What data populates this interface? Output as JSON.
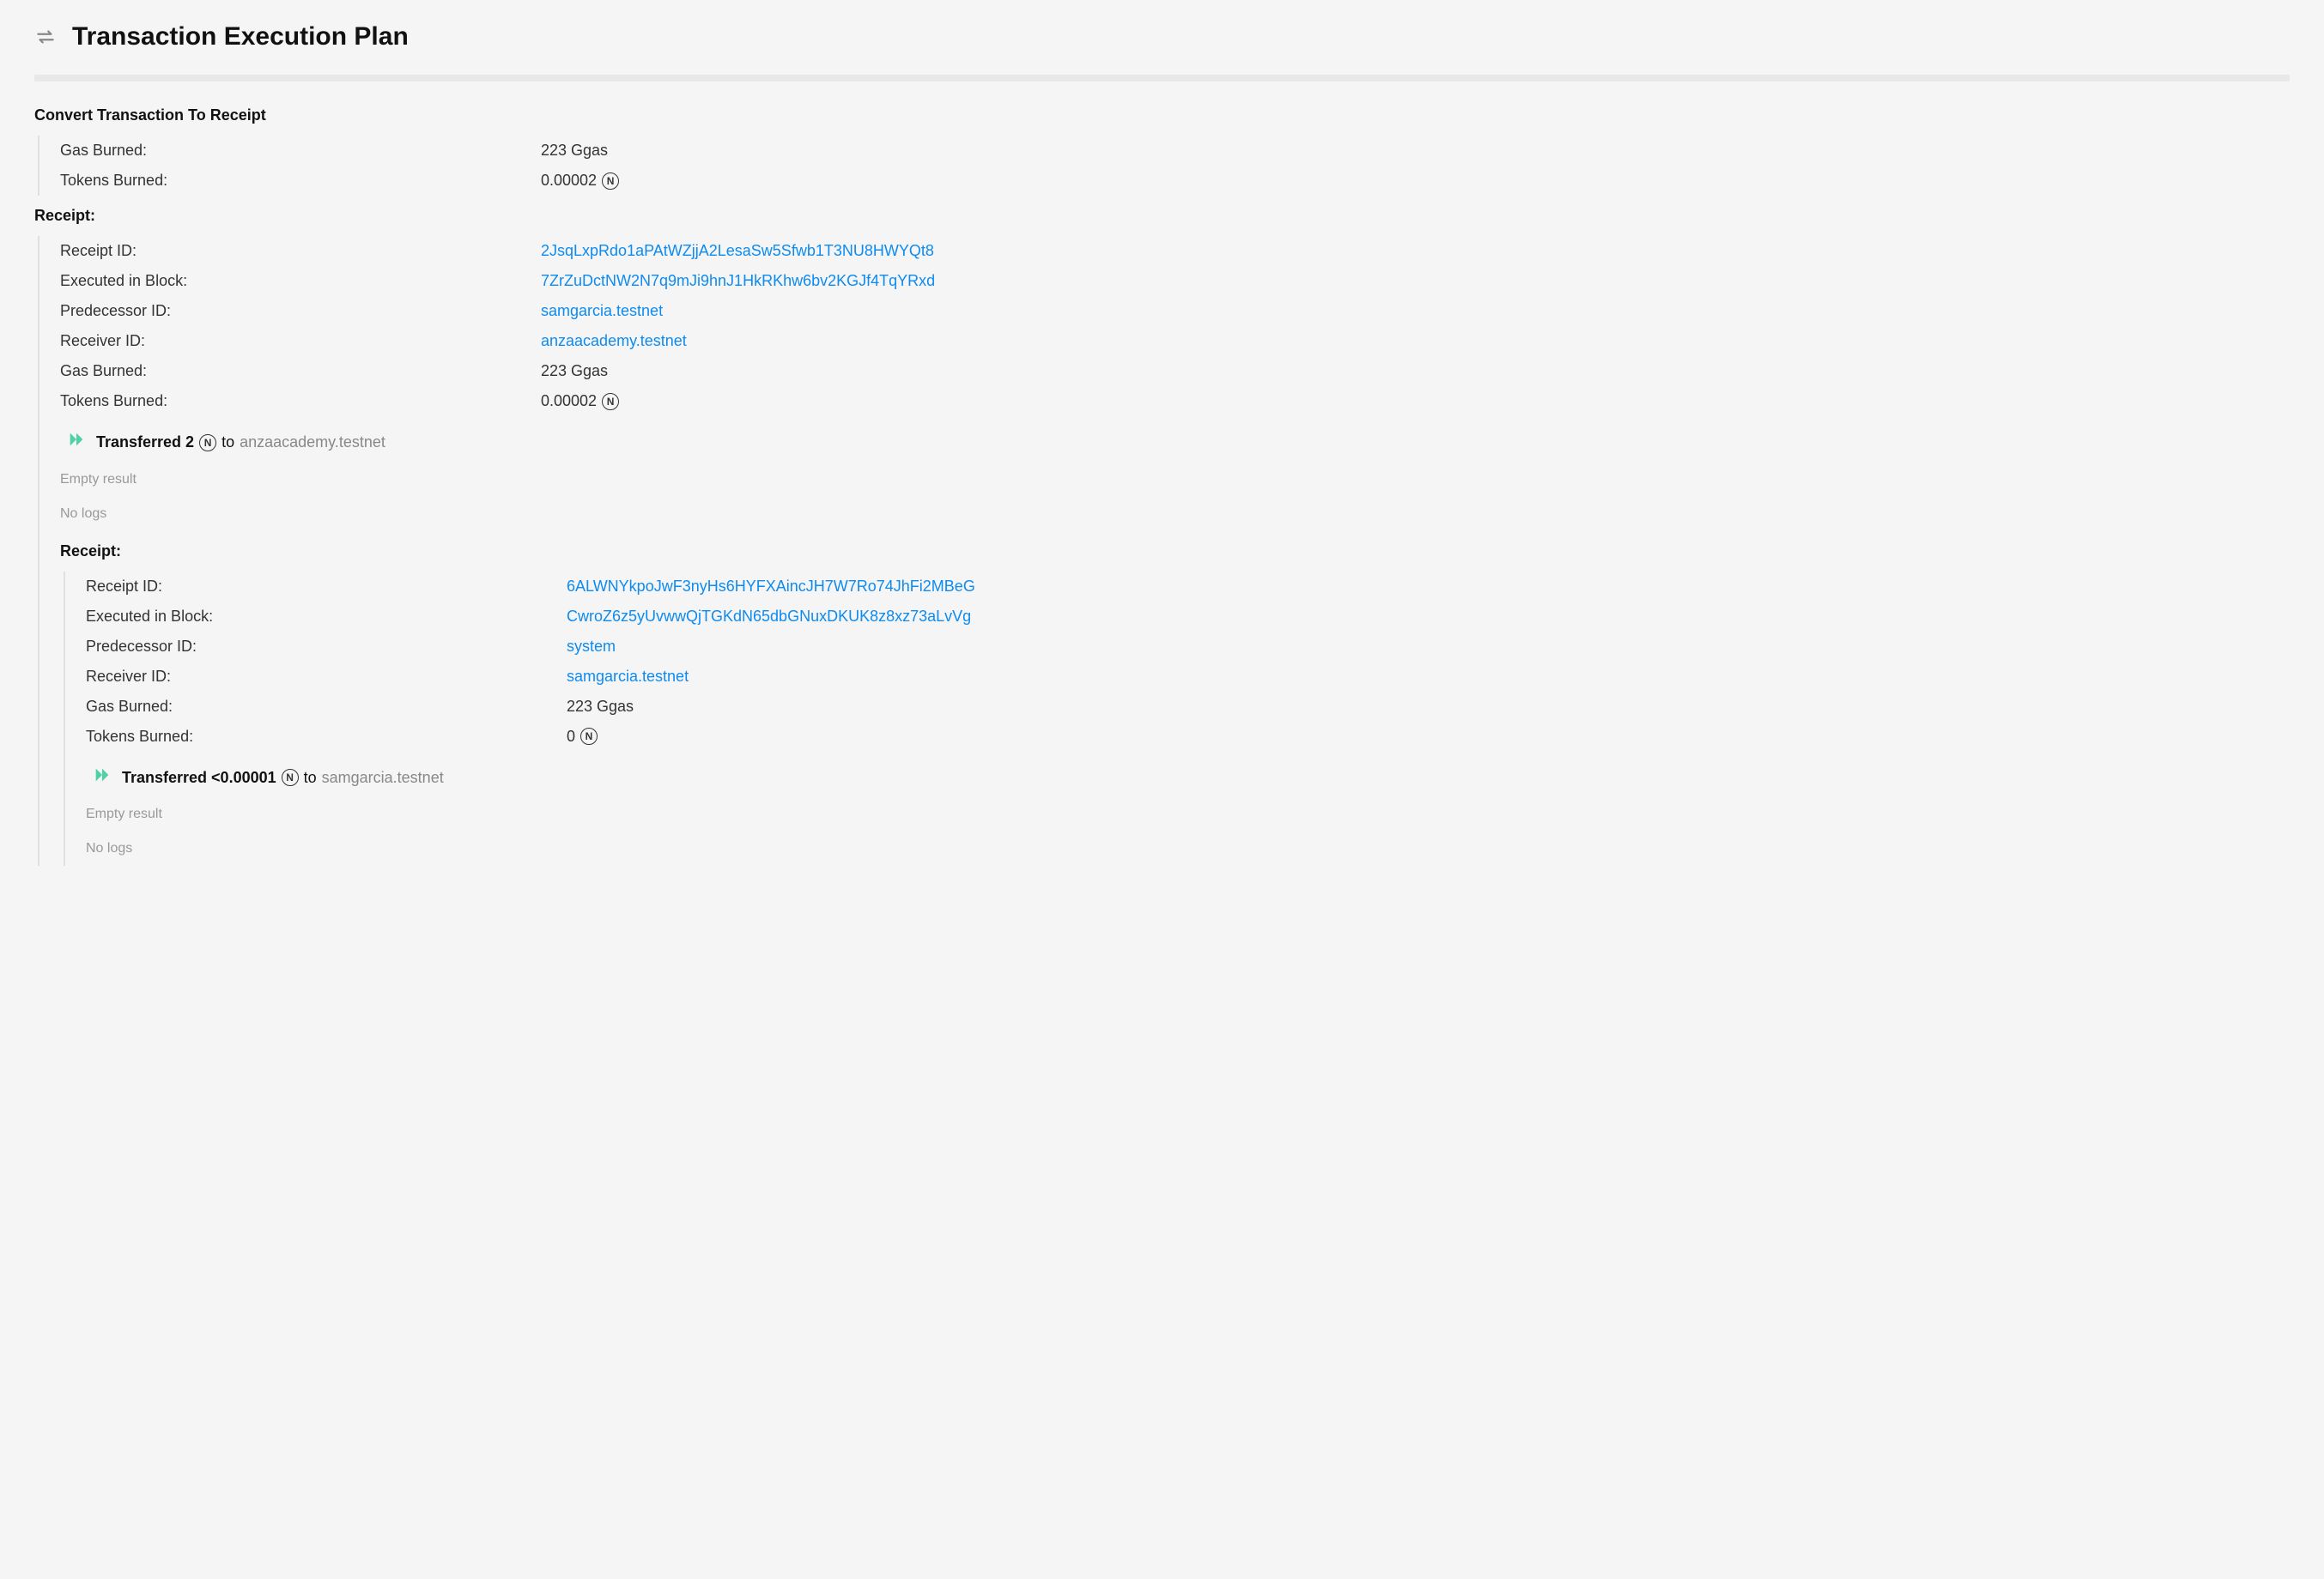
{
  "pageTitle": "Transaction Execution Plan",
  "sections": {
    "convert": {
      "heading": "Convert Transaction To Receipt",
      "gasBurnedLabel": "Gas Burned:",
      "gasBurnedValue": "223 Ggas",
      "tokensBurnedLabel": "Tokens Burned:",
      "tokensBurnedValue": "0.00002"
    },
    "receipt1": {
      "heading": "Receipt:",
      "receiptIdLabel": "Receipt ID:",
      "receiptIdValue": "2JsqLxpRdo1aPAtWZjjA2LesaSw5Sfwb1T3NU8HWYQt8",
      "executedInBlockLabel": "Executed in Block:",
      "executedInBlockValue": "7ZrZuDctNW2N7q9mJi9hnJ1HkRKhw6bv2KGJf4TqYRxd",
      "predecessorIdLabel": "Predecessor ID:",
      "predecessorIdValue": "samgarcia.testnet",
      "receiverIdLabel": "Receiver ID:",
      "receiverIdValue": "anzaacademy.testnet",
      "gasBurnedLabel": "Gas Burned:",
      "gasBurnedValue": "223 Ggas",
      "tokensBurnedLabel": "Tokens Burned:",
      "tokensBurnedValue": "0.00002",
      "transferPrefix": "Transferred 2",
      "transferTo": "to",
      "transferRecipient": "anzaacademy.testnet",
      "emptyResult": "Empty result",
      "noLogs": "No logs"
    },
    "receipt2": {
      "heading": "Receipt:",
      "receiptIdLabel": "Receipt ID:",
      "receiptIdValue": "6ALWNYkpoJwF3nyHs6HYFXAincJH7W7Ro74JhFi2MBeG",
      "executedInBlockLabel": "Executed in Block:",
      "executedInBlockValue": "CwroZ6z5yUvwwQjTGKdN65dbGNuxDKUK8z8xz73aLvVg",
      "predecessorIdLabel": "Predecessor ID:",
      "predecessorIdValue": "system",
      "receiverIdLabel": "Receiver ID:",
      "receiverIdValue": "samgarcia.testnet",
      "gasBurnedLabel": "Gas Burned:",
      "gasBurnedValue": "223 Ggas",
      "tokensBurnedLabel": "Tokens Burned:",
      "tokensBurnedValue": "0",
      "transferPrefix": "Transferred <0.00001",
      "transferTo": "to",
      "transferRecipient": "samgarcia.testnet",
      "emptyResult": "Empty result",
      "noLogs": "No logs"
    }
  }
}
